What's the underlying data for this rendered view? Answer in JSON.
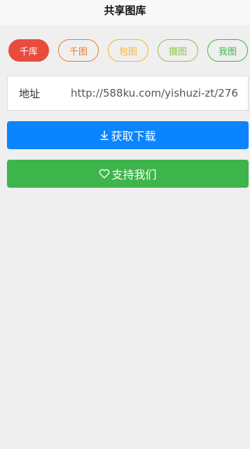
{
  "header": {
    "title": "共享图库"
  },
  "tabs": [
    {
      "label": "千库",
      "color": "#e74c3c",
      "active": true
    },
    {
      "label": "千图",
      "color": "#f07c2a",
      "active": false
    },
    {
      "label": "包图",
      "color": "#f5b52a",
      "active": false
    },
    {
      "label": "摄图",
      "color": "#8bc34a",
      "active": false
    },
    {
      "label": "我图",
      "color": "#3db54a",
      "active": false
    }
  ],
  "url_field": {
    "label": "地址",
    "value": "http://588ku.com/yishuzi-zt/276"
  },
  "buttons": {
    "download": {
      "label": "获取下载",
      "icon": "download-icon",
      "color": "#0a84ff"
    },
    "support": {
      "label": "支持我们",
      "icon": "heart-icon",
      "color": "#3db54a"
    }
  }
}
